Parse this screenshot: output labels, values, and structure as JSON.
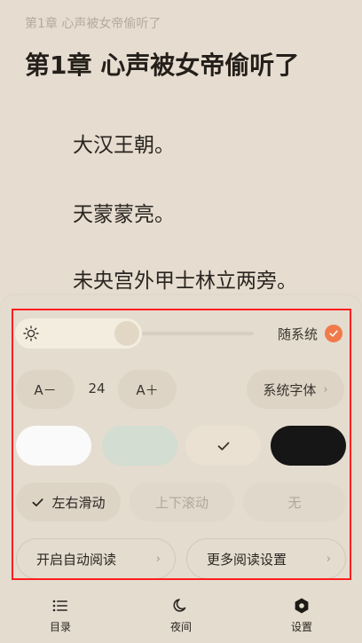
{
  "reader": {
    "chapter_header": "第1章 心声被女帝偷听了",
    "chapter_title": "第1章 心声被女帝偷听了",
    "paragraphs": [
      "大汉王朝。",
      "天蒙蒙亮。",
      "未央宫外甲士林立两旁。"
    ]
  },
  "settings": {
    "brightness": {
      "level": 0.47,
      "follow_system_label": "随系统",
      "follow_system_checked": true
    },
    "font": {
      "decrease_label": "A－",
      "size": "24",
      "increase_label": "A＋",
      "family_label": "系统字体"
    },
    "themes": [
      {
        "name": "white",
        "color": "#fafafa",
        "selected": false
      },
      {
        "name": "green",
        "color": "#d3ddd2",
        "selected": false
      },
      {
        "name": "beige",
        "color": "#ebe1d3",
        "selected": true
      },
      {
        "name": "black",
        "color": "#161616",
        "selected": false
      }
    ],
    "scroll_modes": [
      {
        "label": "左右滑动",
        "selected": true
      },
      {
        "label": "上下滚动",
        "selected": false
      },
      {
        "label": "无",
        "selected": false
      }
    ],
    "auto_read_label": "开启自动阅读",
    "more_settings_label": "更多阅读设置",
    "accent_color": "#f07a4a"
  },
  "nav": {
    "toc_label": "目录",
    "night_label": "夜间",
    "settings_label": "设置"
  }
}
